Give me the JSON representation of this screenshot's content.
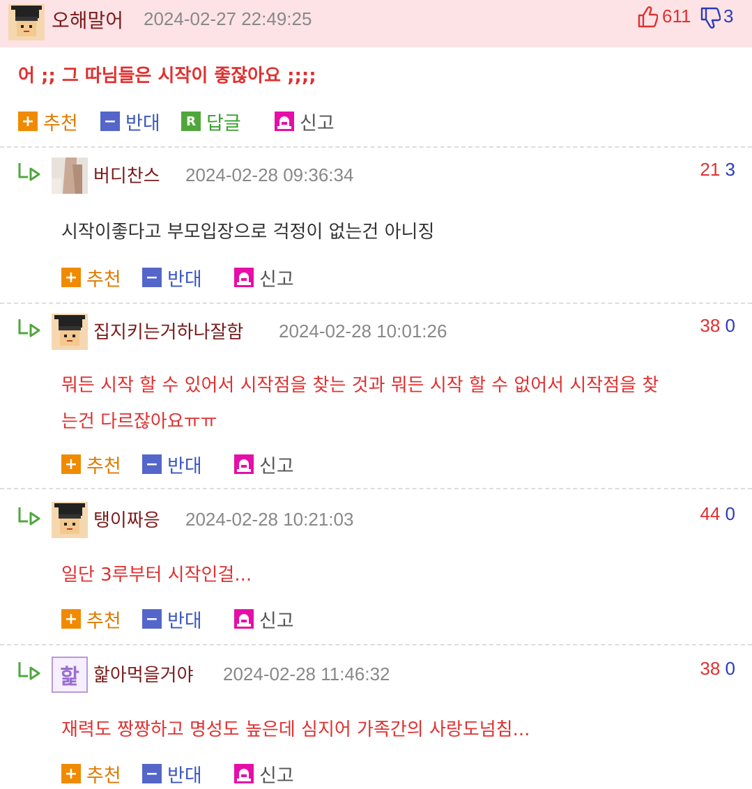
{
  "main_post": {
    "nickname": "오해말어",
    "timestamp": "2024-02-27 22:49:25",
    "upvotes": "611",
    "downvotes": "3",
    "content": "어 ;; 그 따님들은 시작이 좋잖아요 ;;;;",
    "actions": {
      "recommend": "추천",
      "oppose": "반대",
      "reply": "답글",
      "report": "신고"
    },
    "action_icons": {
      "recommend": "plus-icon",
      "oppose": "minus-icon",
      "reply": "r-icon",
      "report": "siren-icon"
    }
  },
  "comments": [
    {
      "nickname": "버디찬스",
      "timestamp": "2024-02-28 09:36:34",
      "upvotes": "21",
      "downvotes": "3",
      "lines": [
        "시작이좋다고 부모입장으로 걱정이 없는건 아니징"
      ],
      "color": "#333333"
    },
    {
      "nickname": "집지키는거하나잘함",
      "timestamp": "2024-02-28 10:01:26",
      "upvotes": "38",
      "downvotes": "0",
      "lines": [
        "뭐든 시작 할 수 있어서 시작점을 찾는 것과 뭐든 시작 할 수 없어서 시작점을 찾",
        "는건 다르잖아요ㅠㅠ"
      ],
      "color": "#e03030"
    },
    {
      "nickname": "탱이짜응",
      "timestamp": "2024-02-28 10:21:03",
      "upvotes": "44",
      "downvotes": "0",
      "lines": [
        "일단 3루부터 시작인걸..."
      ],
      "color": "#e03030"
    },
    {
      "nickname": "핥아먹을거야",
      "timestamp": "2024-02-28 11:46:32",
      "upvotes": "38",
      "downvotes": "0",
      "lines": [
        "재력도 짱짱하고 명성도 높은데 심지어 가족간의 사랑도넘침..."
      ],
      "color": "#e03030",
      "avatar_text": "핥"
    }
  ],
  "comment_actions": {
    "recommend": "추천",
    "oppose": "반대",
    "report": "신고"
  },
  "colors": {
    "header_bg": "#fde3e6",
    "upvote": "#e03030",
    "downvote": "#2a3bb8",
    "nickname": "#7a1a1a"
  }
}
